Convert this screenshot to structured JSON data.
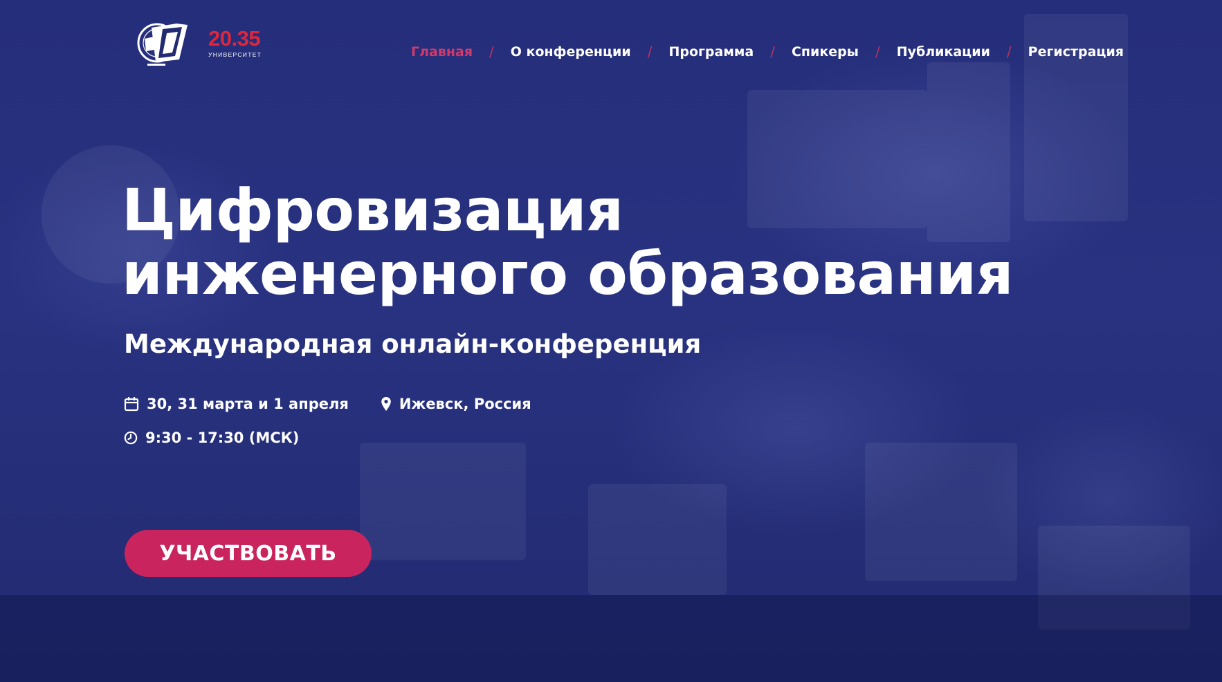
{
  "logo": {
    "number": "20.35",
    "subtitle": "УНИВЕРСИТЕТ"
  },
  "nav": {
    "items": [
      {
        "label": "Главная",
        "active": true
      },
      {
        "label": "О конференции"
      },
      {
        "label": "Программа"
      },
      {
        "label": "Спикеры"
      },
      {
        "label": "Публикации"
      },
      {
        "label": "Регистрация"
      }
    ],
    "separator": "/"
  },
  "hero": {
    "title_line1": "Цифровизация",
    "title_line2": "инженерного образования",
    "subtitle": "Международная онлайн-конференция"
  },
  "details": {
    "dates": "30, 31 марта и 1 апреля",
    "location": "Ижевск, Россия",
    "time": "9:30 - 17:30 (МСК)"
  },
  "cta": {
    "label": "УЧАСТВОВАТЬ"
  },
  "colors": {
    "background": "#222a72",
    "accent": "#c9245d",
    "nav_active": "#d23a6e",
    "logo_red": "#e0263b",
    "text": "#ffffff"
  },
  "icons": {
    "dates": "calendar-icon",
    "location": "map-pin-icon",
    "time": "clock-icon"
  }
}
